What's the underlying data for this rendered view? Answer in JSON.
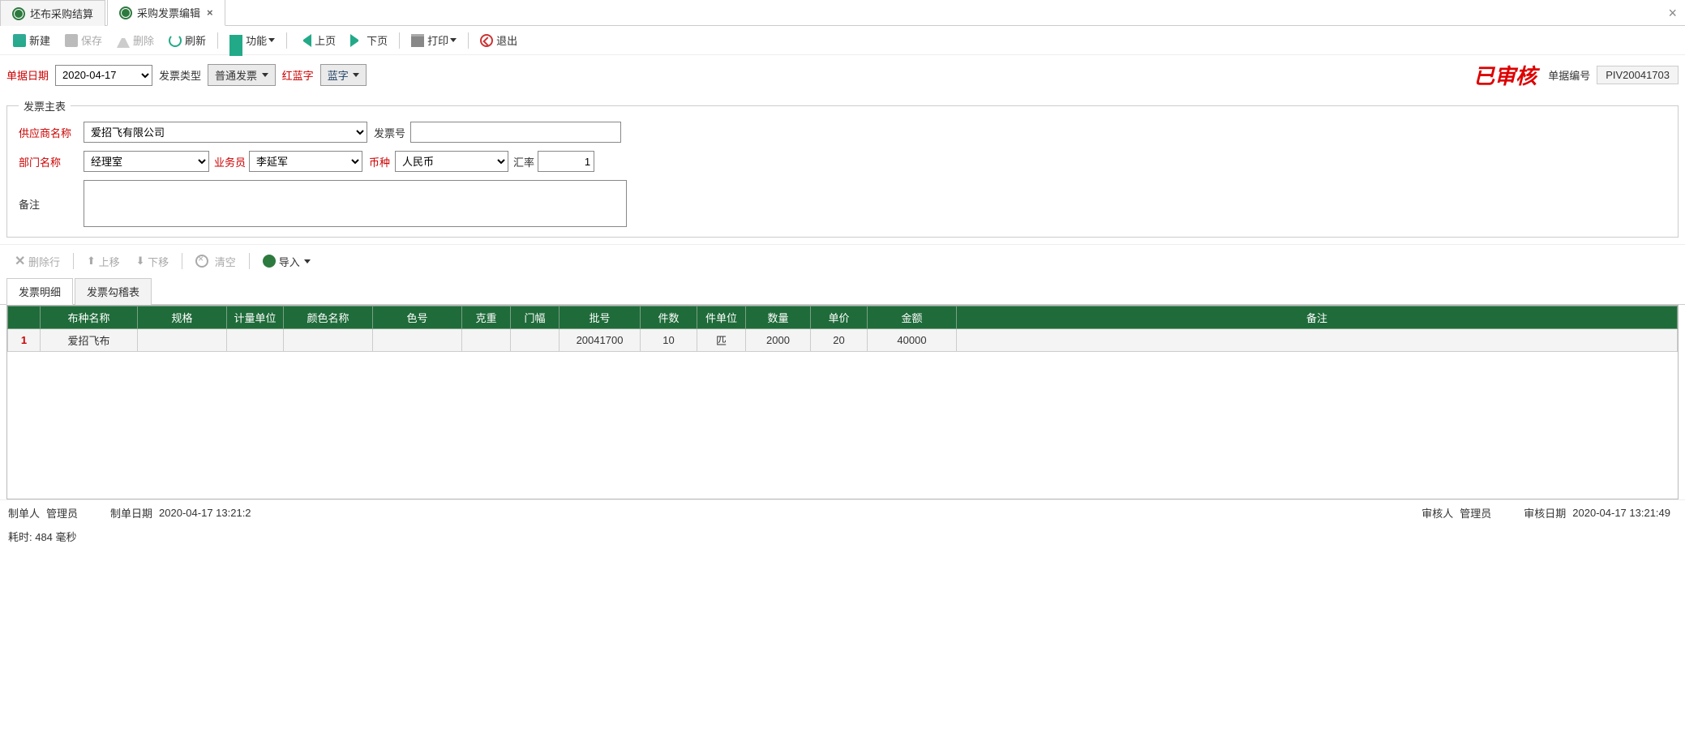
{
  "tabs": {
    "items": [
      {
        "label": "坯布采购结算",
        "active": false,
        "closable": false
      },
      {
        "label": "采购发票编辑",
        "active": true,
        "closable": true
      }
    ]
  },
  "toolbar": {
    "new": "新建",
    "save": "保存",
    "delete": "删除",
    "refresh": "刷新",
    "func": "功能",
    "prev": "上页",
    "next": "下页",
    "print": "打印",
    "exit": "退出"
  },
  "header": {
    "doc_date_label": "单据日期",
    "doc_date": "2020-04-17",
    "invoice_type_label": "发票类型",
    "invoice_type": "普通发票",
    "redblue_label": "红蓝字",
    "redblue_value": "蓝字",
    "audit_stamp": "已审核",
    "doc_no_label": "单据编号",
    "doc_no": "PIV20041703"
  },
  "fieldset_title": "发票主表",
  "form": {
    "supplier_label": "供应商名称",
    "supplier": "爱招飞有限公司",
    "invoice_no_label": "发票号",
    "invoice_no": "",
    "dept_label": "部门名称",
    "dept": "经理室",
    "sales_label": "业务员",
    "sales": "李延军",
    "currency_label": "币种",
    "currency": "人民币",
    "rate_label": "汇率",
    "rate": "1",
    "remark_label": "备注",
    "remark": ""
  },
  "row_toolbar": {
    "del_row": "删除行",
    "move_up": "上移",
    "move_down": "下移",
    "clear": "清空",
    "import": "导入"
  },
  "subtabs": {
    "detail": "发票明细",
    "check": "发票勾稽表"
  },
  "grid": {
    "headers": [
      "布种名称",
      "规格",
      "计量单位",
      "颜色名称",
      "色号",
      "克重",
      "门幅",
      "批号",
      "件数",
      "件单位",
      "数量",
      "单价",
      "金额",
      "备注"
    ],
    "rows": [
      {
        "n": "1",
        "cells": [
          "爱招飞布",
          "",
          "",
          "",
          "",
          "",
          "",
          "20041700",
          "10",
          "匹",
          "2000",
          "20",
          "40000",
          ""
        ]
      }
    ]
  },
  "footer": {
    "maker_label": "制单人",
    "maker": "管理员",
    "make_date_label": "制单日期",
    "make_date": "2020-04-17 13:21:2",
    "auditor_label": "审核人",
    "auditor": "管理员",
    "audit_date_label": "审核日期",
    "audit_date": "2020-04-17 13:21:49"
  },
  "status": "耗时: 484 毫秒"
}
